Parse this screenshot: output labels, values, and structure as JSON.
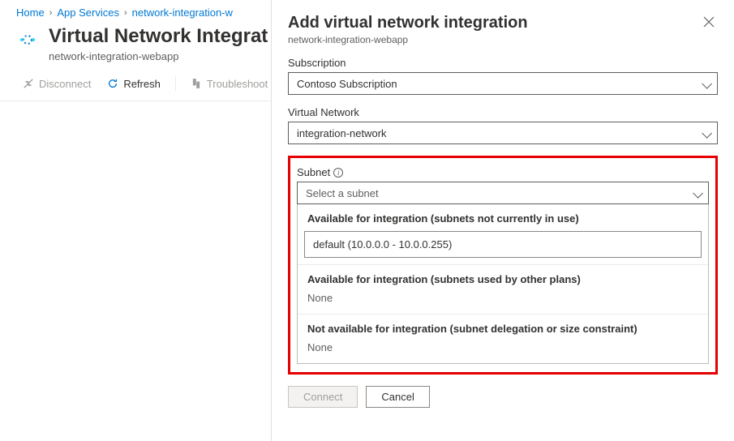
{
  "breadcrumb": {
    "home": "Home",
    "app_services": "App Services",
    "resource": "network-integration-w"
  },
  "header": {
    "title": "Virtual Network Integrat",
    "subtitle": "network-integration-webapp"
  },
  "toolbar": {
    "disconnect": "Disconnect",
    "refresh": "Refresh",
    "troubleshoot": "Troubleshoot"
  },
  "panel": {
    "title": "Add virtual network integration",
    "subtitle": "network-integration-webapp",
    "subscription_label": "Subscription",
    "subscription_value": "Contoso Subscription",
    "vnet_label": "Virtual Network",
    "vnet_value": "integration-network",
    "subnet_label": "Subnet",
    "subnet_placeholder": "Select a subnet",
    "sections": {
      "available_free": "Available for integration (subnets not currently in use)",
      "available_option": "default (10.0.0.0 - 10.0.0.255)",
      "available_used": "Available for integration (subnets used by other plans)",
      "not_available": "Not available for integration (subnet delegation or size constraint)",
      "none": "None"
    },
    "connect": "Connect",
    "cancel": "Cancel"
  }
}
